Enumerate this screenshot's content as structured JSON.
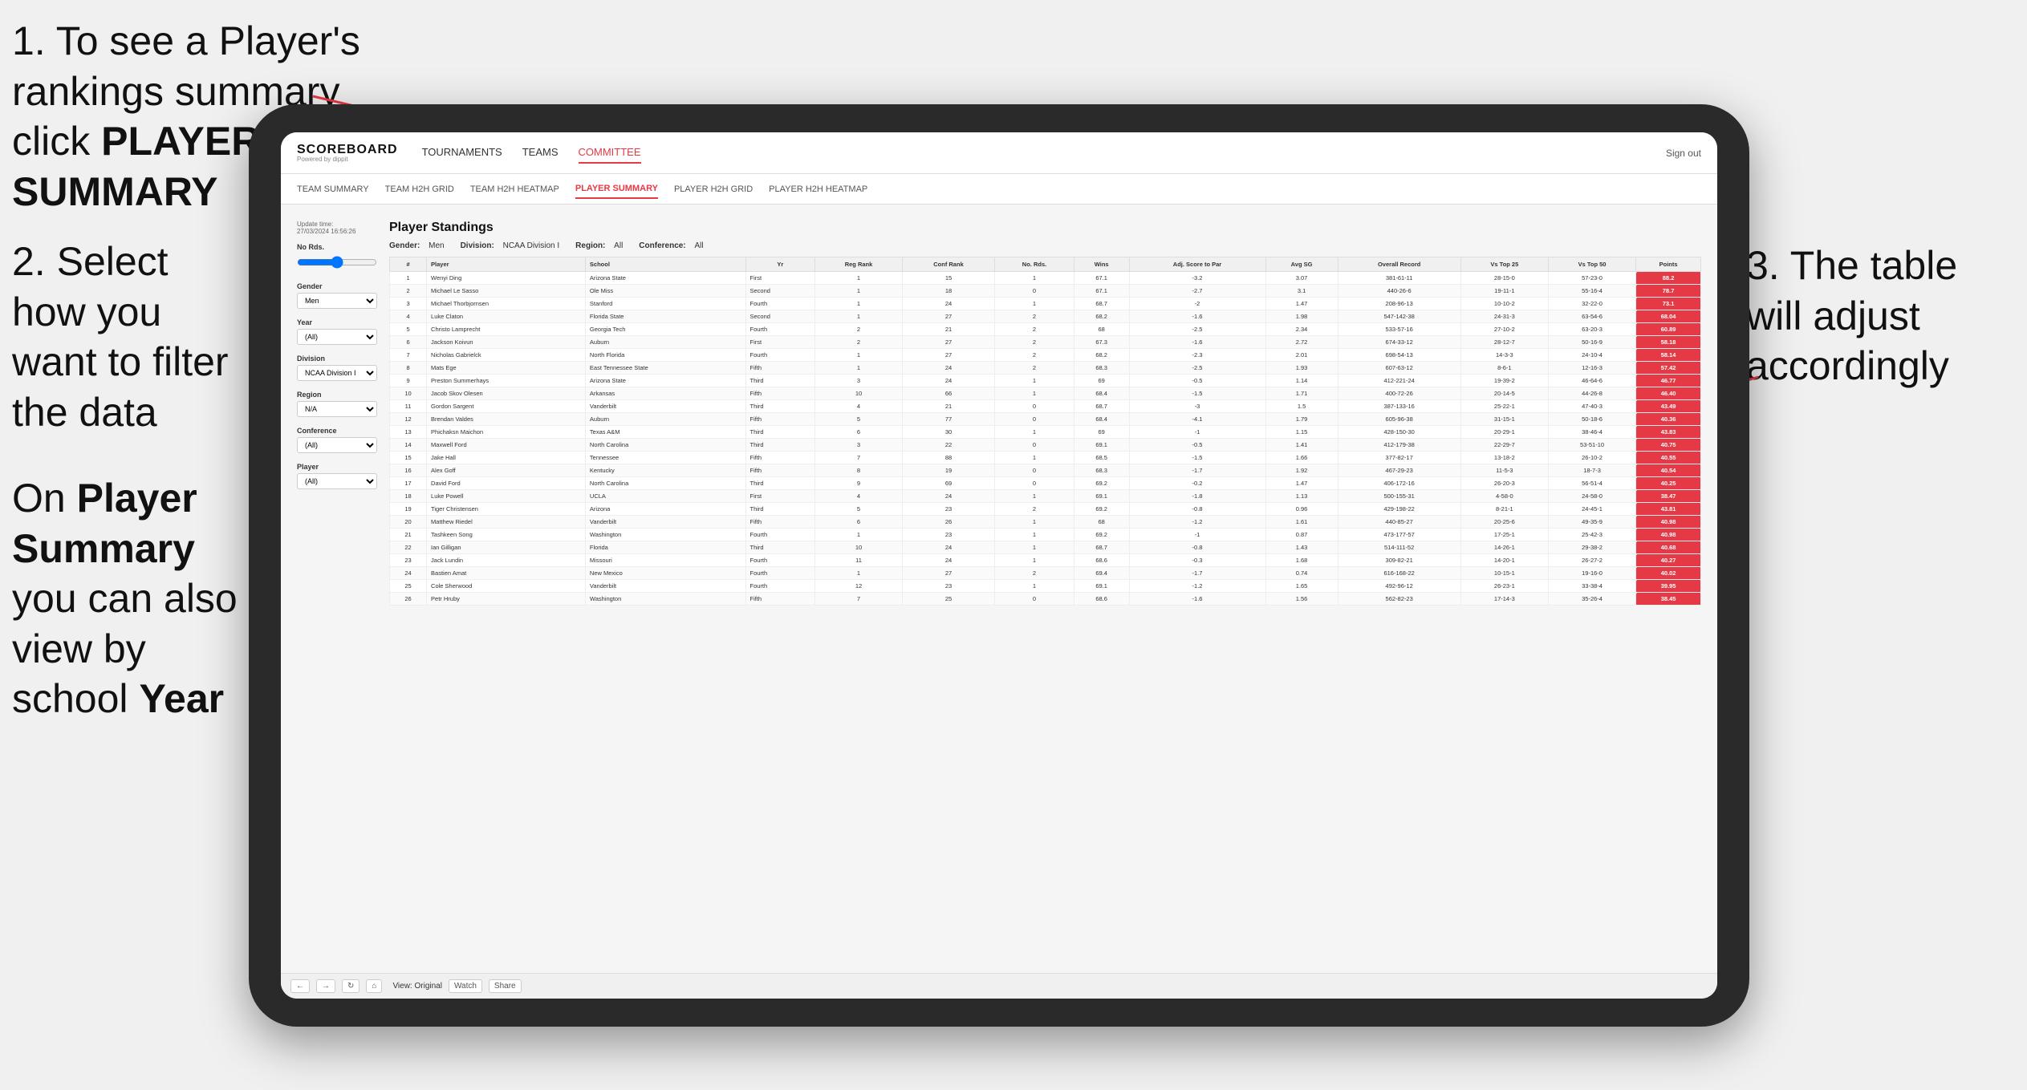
{
  "instructions": {
    "step1": "1. To see a Player's rankings summary click ",
    "step1_bold": "PLAYER SUMMARY",
    "step2_line1": "2. Select how you want to filter the data",
    "step2_bold": "",
    "bottom_label1": "On ",
    "bottom_bold1": "Player Summary",
    "bottom_label2": " you can also view by school ",
    "bottom_bold2": "Year",
    "right_label": "3. The table will adjust accordingly"
  },
  "app": {
    "logo": "SCOREBOARD",
    "logo_sub": "Powered by dippit",
    "sign_out": "Sign out"
  },
  "nav": {
    "items": [
      "TOURNAMENTS",
      "TEAMS",
      "COMMITTEE"
    ],
    "active": "COMMITTEE"
  },
  "subnav": {
    "items": [
      "TEAM SUMMARY",
      "TEAM H2H GRID",
      "TEAM H2H HEATMAP",
      "PLAYER SUMMARY",
      "PLAYER H2H GRID",
      "PLAYER H2H HEATMAP"
    ],
    "active": "PLAYER SUMMARY"
  },
  "table": {
    "title": "Player Standings",
    "update_time_label": "Update time:",
    "update_time": "27/03/2024 16:56:26",
    "filters": {
      "gender_label": "Gender:",
      "gender": "Men",
      "division_label": "Division:",
      "division": "NCAA Division I",
      "region_label": "Region:",
      "region": "All",
      "conference_label": "Conference:",
      "conference": "All"
    },
    "left_filters": {
      "no_rds_label": "No Rds.",
      "gender_label": "Gender",
      "gender_val": "Men",
      "year_label": "Year",
      "year_val": "(All)",
      "division_label": "Division",
      "division_val": "NCAA Division I",
      "region_label": "Region",
      "region_val": "N/A",
      "conference_label": "Conference",
      "conference_val": "(All)",
      "player_label": "Player",
      "player_val": "(All)"
    },
    "columns": [
      "#",
      "Player",
      "School",
      "Yr",
      "Reg Rank",
      "Conf Rank",
      "No. Rds.",
      "Wins",
      "Adj. Score to Par",
      "Avg SG",
      "Overall Record",
      "Vs Top 25",
      "Vs Top 50",
      "Points"
    ],
    "rows": [
      {
        "rank": 1,
        "player": "Wenyi Ding",
        "school": "Arizona State",
        "yr": "First",
        "reg_rank": 1,
        "conf_rank": 15,
        "no_rds": 1,
        "wins": 67.1,
        "adj": -3.2,
        "avg_sg": 3.07,
        "overall": "381-61-11",
        "top25": "28-15-0",
        "top50": "57-23-0",
        "points": "88.2"
      },
      {
        "rank": 2,
        "player": "Michael Le Sasso",
        "school": "Ole Miss",
        "yr": "Second",
        "reg_rank": 1,
        "conf_rank": 18,
        "no_rds": 0,
        "wins": 67.1,
        "adj": -2.7,
        "avg_sg": 3.1,
        "overall": "440-26-6",
        "top25": "19-11-1",
        "top50": "55-16-4",
        "points": "78.7"
      },
      {
        "rank": 3,
        "player": "Michael Thorbjornsen",
        "school": "Stanford",
        "yr": "Fourth",
        "reg_rank": 1,
        "conf_rank": 24,
        "no_rds": 1,
        "wins": 68.7,
        "adj": -2.0,
        "avg_sg": 1.47,
        "overall": "208-96-13",
        "top25": "10-10-2",
        "top50": "32-22-0",
        "points": "73.1"
      },
      {
        "rank": 4,
        "player": "Luke Claton",
        "school": "Florida State",
        "yr": "Second",
        "reg_rank": 1,
        "conf_rank": 27,
        "no_rds": 2,
        "wins": 68.2,
        "adj": -1.6,
        "avg_sg": 1.98,
        "overall": "547-142-38",
        "top25": "24-31-3",
        "top50": "63-54-6",
        "points": "68.04"
      },
      {
        "rank": 5,
        "player": "Christo Lamprecht",
        "school": "Georgia Tech",
        "yr": "Fourth",
        "reg_rank": 2,
        "conf_rank": 21,
        "no_rds": 2,
        "wins": 68.0,
        "adj": -2.5,
        "avg_sg": 2.34,
        "overall": "533-57-16",
        "top25": "27-10-2",
        "top50": "63-20-3",
        "points": "60.89"
      },
      {
        "rank": 6,
        "player": "Jackson Koivun",
        "school": "Auburn",
        "yr": "First",
        "reg_rank": 2,
        "conf_rank": 27,
        "no_rds": 2,
        "wins": 67.3,
        "adj": -1.6,
        "avg_sg": 2.72,
        "overall": "674-33-12",
        "top25": "28-12-7",
        "top50": "50-16-9",
        "points": "58.18"
      },
      {
        "rank": 7,
        "player": "Nicholas Gabrielck",
        "school": "North Florida",
        "yr": "Fourth",
        "reg_rank": 1,
        "conf_rank": 27,
        "no_rds": 2,
        "wins": 68.2,
        "adj": -2.3,
        "avg_sg": 2.01,
        "overall": "698-54-13",
        "top25": "14-3-3",
        "top50": "24-10-4",
        "points": "58.14"
      },
      {
        "rank": 8,
        "player": "Mats Ege",
        "school": "East Tennessee State",
        "yr": "Fifth",
        "reg_rank": 1,
        "conf_rank": 24,
        "no_rds": 2,
        "wins": 68.3,
        "adj": -2.5,
        "avg_sg": 1.93,
        "overall": "607-63-12",
        "top25": "8-6-1",
        "top50": "12-16-3",
        "points": "57.42"
      },
      {
        "rank": 9,
        "player": "Preston Summerhays",
        "school": "Arizona State",
        "yr": "Third",
        "reg_rank": 3,
        "conf_rank": 24,
        "no_rds": 1,
        "wins": 69.0,
        "adj": -0.5,
        "avg_sg": 1.14,
        "overall": "412-221-24",
        "top25": "19-39-2",
        "top50": "46-64-6",
        "points": "46.77"
      },
      {
        "rank": 10,
        "player": "Jacob Skov Olesen",
        "school": "Arkansas",
        "yr": "Fifth",
        "reg_rank": 10,
        "conf_rank": 66,
        "no_rds": 1,
        "wins": 68.4,
        "adj": -1.5,
        "avg_sg": 1.71,
        "overall": "400-72-26",
        "top25": "20-14-5",
        "top50": "44-26-8",
        "points": "46.40"
      },
      {
        "rank": 11,
        "player": "Gordon Sargent",
        "school": "Vanderbilt",
        "yr": "Third",
        "reg_rank": 4,
        "conf_rank": 21,
        "no_rds": 0,
        "wins": 68.7,
        "adj": -3.0,
        "avg_sg": 1.5,
        "overall": "387-133-16",
        "top25": "25-22-1",
        "top50": "47-40-3",
        "points": "43.49"
      },
      {
        "rank": 12,
        "player": "Brendan Valdes",
        "school": "Auburn",
        "yr": "Fifth",
        "reg_rank": 5,
        "conf_rank": 77,
        "no_rds": 0,
        "wins": 68.4,
        "adj": -4.1,
        "avg_sg": 1.79,
        "overall": "605-96-38",
        "top25": "31-15-1",
        "top50": "50-18-6",
        "points": "40.36"
      },
      {
        "rank": 13,
        "player": "Phichaksn Maichon",
        "school": "Texas A&M",
        "yr": "Third",
        "reg_rank": 6,
        "conf_rank": 30,
        "no_rds": 1,
        "wins": 69.0,
        "adj": -1.0,
        "avg_sg": 1.15,
        "overall": "428-150-30",
        "top25": "20-29-1",
        "top50": "38-46-4",
        "points": "43.83"
      },
      {
        "rank": 14,
        "player": "Maxwell Ford",
        "school": "North Carolina",
        "yr": "Third",
        "reg_rank": 3,
        "conf_rank": 22,
        "no_rds": 0,
        "wins": 69.1,
        "adj": -0.5,
        "avg_sg": 1.41,
        "overall": "412-179-38",
        "top25": "22-29-7",
        "top50": "53-51-10",
        "points": "40.75"
      },
      {
        "rank": 15,
        "player": "Jake Hall",
        "school": "Tennessee",
        "yr": "Fifth",
        "reg_rank": 7,
        "conf_rank": 88,
        "no_rds": 1,
        "wins": 68.5,
        "adj": -1.5,
        "avg_sg": 1.66,
        "overall": "377-82-17",
        "top25": "13-18-2",
        "top50": "26-10-2",
        "points": "40.55"
      },
      {
        "rank": 16,
        "player": "Alex Goff",
        "school": "Kentucky",
        "yr": "Fifth",
        "reg_rank": 8,
        "conf_rank": 19,
        "no_rds": 0,
        "wins": 68.3,
        "adj": -1.7,
        "avg_sg": 1.92,
        "overall": "467-29-23",
        "top25": "11-5-3",
        "top50": "18-7-3",
        "points": "40.54"
      },
      {
        "rank": 17,
        "player": "David Ford",
        "school": "North Carolina",
        "yr": "Third",
        "reg_rank": 9,
        "conf_rank": 69,
        "no_rds": 0,
        "wins": 69.2,
        "adj": -0.2,
        "avg_sg": 1.47,
        "overall": "406-172-16",
        "top25": "26-20-3",
        "top50": "56-51-4",
        "points": "40.25"
      },
      {
        "rank": 18,
        "player": "Luke Powell",
        "school": "UCLA",
        "yr": "First",
        "reg_rank": 4,
        "conf_rank": 24,
        "no_rds": 1,
        "wins": 69.1,
        "adj": -1.8,
        "avg_sg": 1.13,
        "overall": "500-155-31",
        "top25": "4-58-0",
        "top50": "24-58-0",
        "points": "38.47"
      },
      {
        "rank": 19,
        "player": "Tiger Christensen",
        "school": "Arizona",
        "yr": "Third",
        "reg_rank": 5,
        "conf_rank": 23,
        "no_rds": 2,
        "wins": 69.2,
        "adj": -0.8,
        "avg_sg": 0.96,
        "overall": "429-198-22",
        "top25": "8-21-1",
        "top50": "24-45-1",
        "points": "43.81"
      },
      {
        "rank": 20,
        "player": "Matthew Riedel",
        "school": "Vanderbilt",
        "yr": "Fifth",
        "reg_rank": 6,
        "conf_rank": 26,
        "no_rds": 1,
        "wins": 68.0,
        "adj": -1.2,
        "avg_sg": 1.61,
        "overall": "440-85-27",
        "top25": "20-25-6",
        "top50": "49-35-9",
        "points": "40.98"
      },
      {
        "rank": 21,
        "player": "Tashkeen Song",
        "school": "Washington",
        "yr": "Fourth",
        "reg_rank": 1,
        "conf_rank": 23,
        "no_rds": 1,
        "wins": 69.2,
        "adj": -1.0,
        "avg_sg": 0.87,
        "overall": "473-177-57",
        "top25": "17-25-1",
        "top50": "25-42-3",
        "points": "40.98"
      },
      {
        "rank": 22,
        "player": "Ian Gilligan",
        "school": "Florida",
        "yr": "Third",
        "reg_rank": 10,
        "conf_rank": 24,
        "no_rds": 1,
        "wins": 68.7,
        "adj": -0.8,
        "avg_sg": 1.43,
        "overall": "514-111-52",
        "top25": "14-26-1",
        "top50": "29-38-2",
        "points": "40.68"
      },
      {
        "rank": 23,
        "player": "Jack Lundin",
        "school": "Missouri",
        "yr": "Fourth",
        "reg_rank": 11,
        "conf_rank": 24,
        "no_rds": 1,
        "wins": 68.6,
        "adj": -0.3,
        "avg_sg": 1.68,
        "overall": "309-82-21",
        "top25": "14-20-1",
        "top50": "26-27-2",
        "points": "40.27"
      },
      {
        "rank": 24,
        "player": "Bastien Amat",
        "school": "New Mexico",
        "yr": "Fourth",
        "reg_rank": 1,
        "conf_rank": 27,
        "no_rds": 2,
        "wins": 69.4,
        "adj": -1.7,
        "avg_sg": 0.74,
        "overall": "616-168-22",
        "top25": "10-15-1",
        "top50": "19-16-0",
        "points": "40.02"
      },
      {
        "rank": 25,
        "player": "Cole Sherwood",
        "school": "Vanderbilt",
        "yr": "Fourth",
        "reg_rank": 12,
        "conf_rank": 23,
        "no_rds": 1,
        "wins": 69.1,
        "adj": -1.2,
        "avg_sg": 1.65,
        "overall": "492-96-12",
        "top25": "26-23-1",
        "top50": "33-38-4",
        "points": "39.95"
      },
      {
        "rank": 26,
        "player": "Petr Hruby",
        "school": "Washington",
        "yr": "Fifth",
        "reg_rank": 7,
        "conf_rank": 25,
        "no_rds": 0,
        "wins": 68.6,
        "adj": -1.6,
        "avg_sg": 1.56,
        "overall": "562-82-23",
        "top25": "17-14-3",
        "top50": "35-26-4",
        "points": "38.45"
      }
    ]
  },
  "toolbar": {
    "view_label": "View: Original",
    "watch_label": "Watch",
    "share_label": "Share"
  }
}
